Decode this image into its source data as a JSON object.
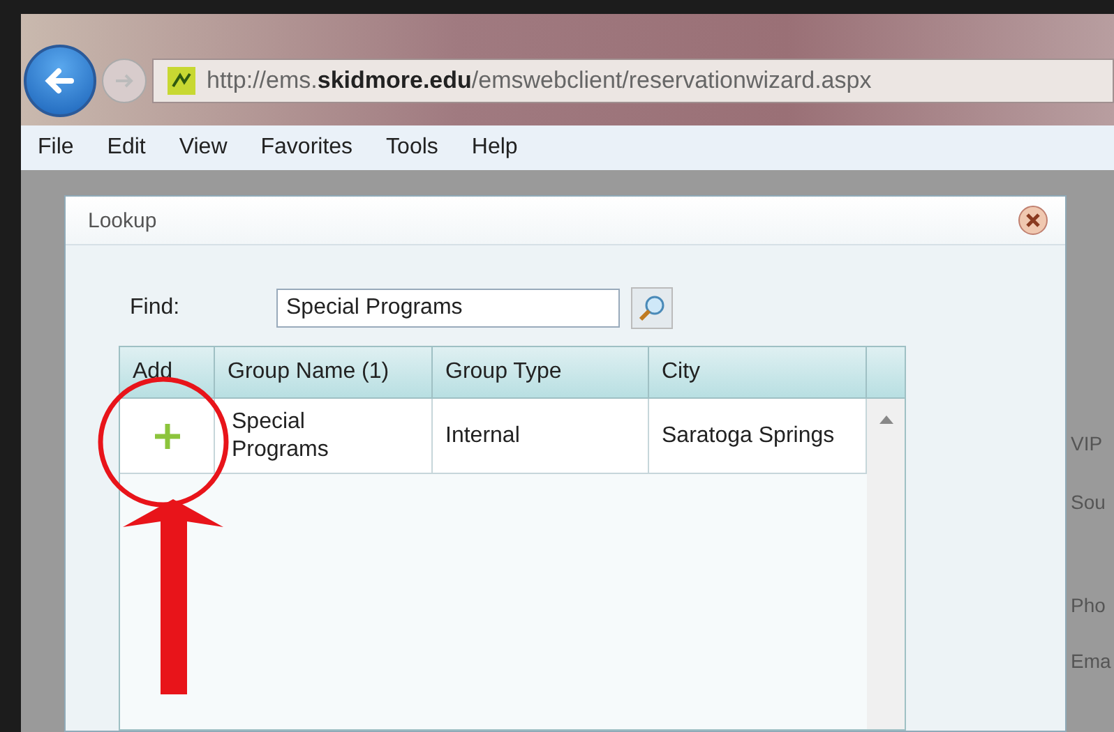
{
  "browser": {
    "url": "http://ems.**skidmore.edu**/emswebclient/reservationwizard.aspx",
    "menu": [
      "File",
      "Edit",
      "View",
      "Favorites",
      "Tools",
      "Help"
    ]
  },
  "dialog": {
    "title": "Lookup",
    "find_label": "Find:",
    "find_value": "Special Programs",
    "table": {
      "columns": [
        "Add",
        "Group Name (1)",
        "Group Type",
        "City"
      ],
      "rows": [
        {
          "group_name": "Special Programs",
          "group_type": "Internal",
          "city": "Saratoga Springs"
        }
      ]
    }
  },
  "page_labels": [
    "VIP",
    "Sou",
    "Pho",
    "Ema"
  ]
}
